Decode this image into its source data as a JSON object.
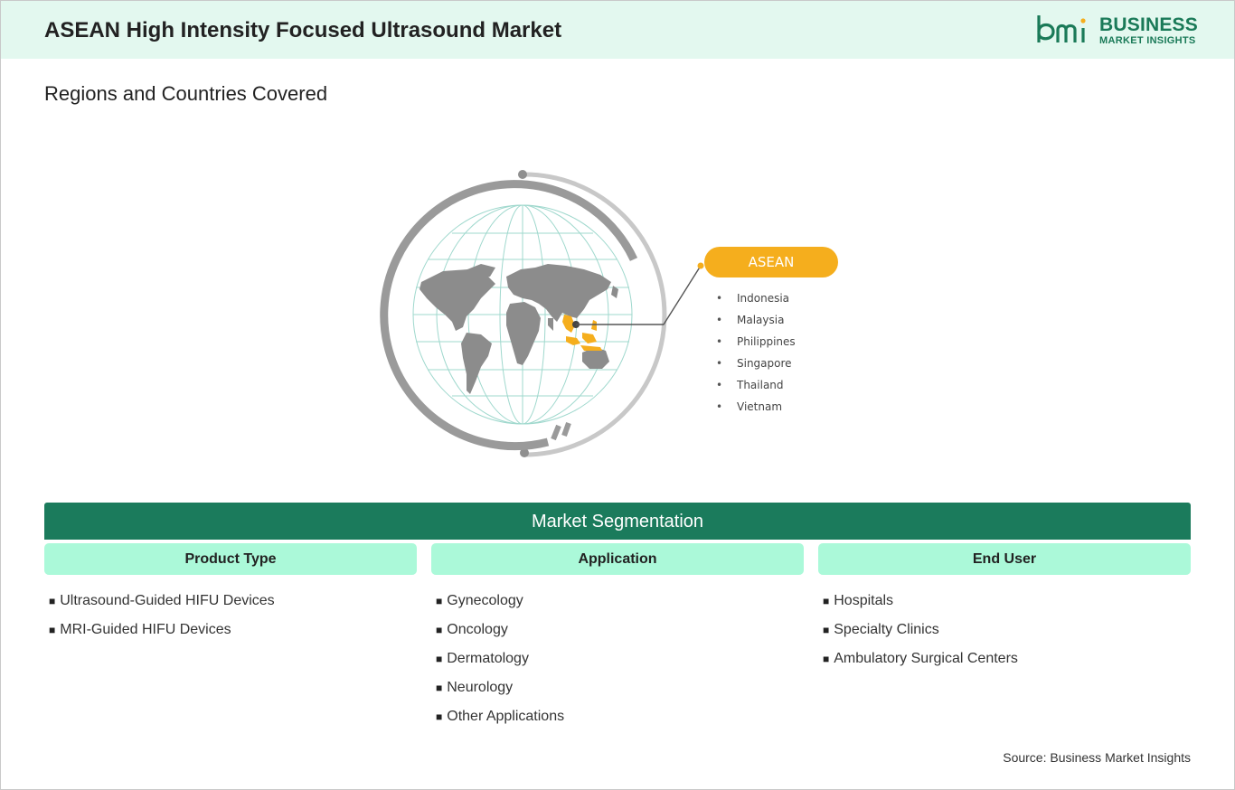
{
  "header": {
    "title": "ASEAN High Intensity Focused Ultrasound Market",
    "logo_line1": "BUSINESS",
    "logo_line2": "MARKET INSIGHTS"
  },
  "regions": {
    "title": "Regions and Countries Covered",
    "region_label": "ASEAN",
    "countries": [
      "Indonesia",
      "Malaysia",
      "Philippines",
      "Singapore",
      "Thailand",
      "Vietnam"
    ]
  },
  "segmentation": {
    "title": "Market Segmentation",
    "columns": [
      {
        "heading": "Product Type",
        "items": [
          "Ultrasound-Guided HIFU Devices",
          "MRI-Guided HIFU Devices"
        ]
      },
      {
        "heading": "Application",
        "items": [
          "Gynecology",
          "Oncology",
          "Dermatology",
          "Neurology",
          "Other Applications"
        ]
      },
      {
        "heading": "End User",
        "items": [
          "Hospitals",
          "Specialty Clinics",
          "Ambulatory Surgical Centers"
        ]
      }
    ]
  },
  "source": "Source: Business Market Insights",
  "colors": {
    "header_bg": "#e3f8ef",
    "brand_green": "#1a7a58",
    "seg_bar": "#1b7b5c",
    "seg_head": "#abf9d9",
    "accent_orange": "#f5ae1d",
    "map_gray": "#8c8c8c"
  },
  "icons": {
    "logo": "bmi-logo-icon",
    "globe": "globe-icon"
  }
}
